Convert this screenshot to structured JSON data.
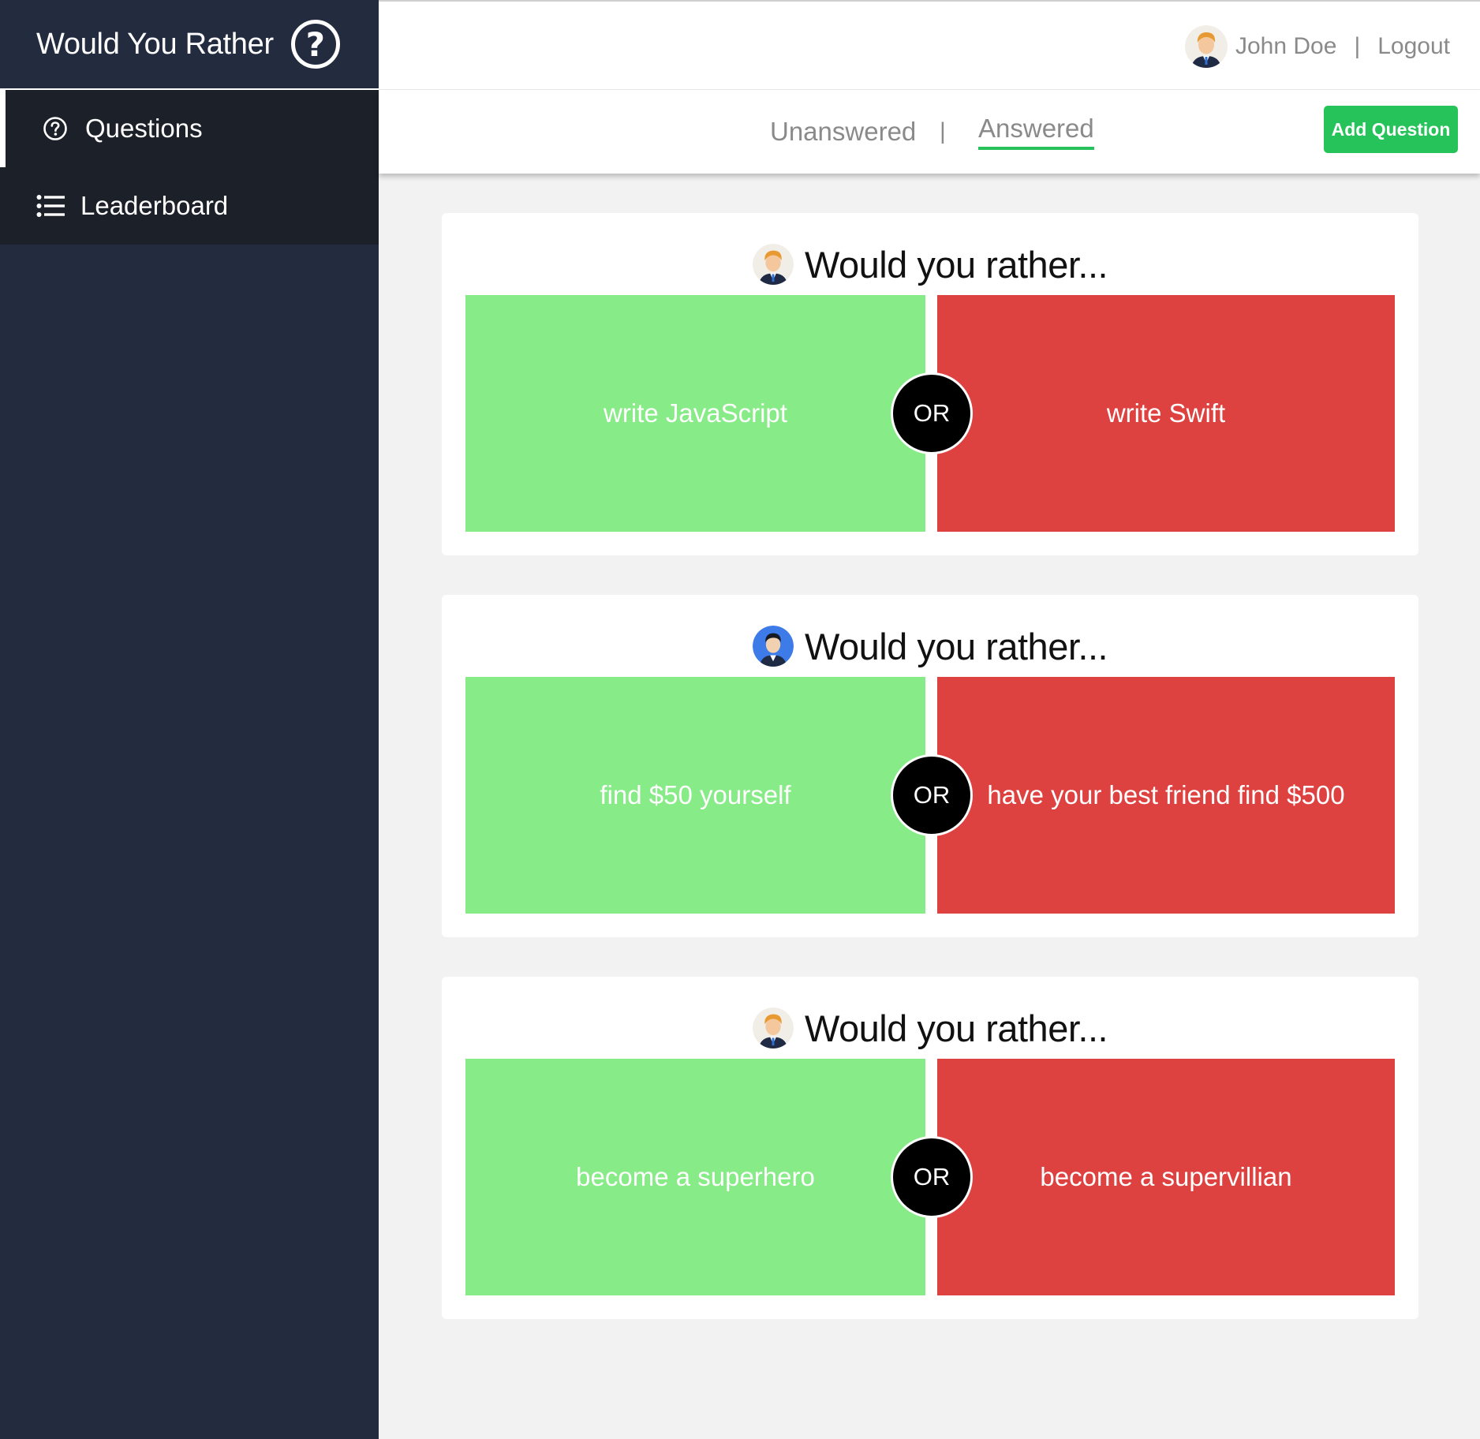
{
  "app": {
    "title": "Would You Rather",
    "brand_icon": "question-circle-icon"
  },
  "sidebar": {
    "items": [
      {
        "label": "Questions",
        "icon": "question-circle-icon",
        "active": true
      },
      {
        "label": "Leaderboard",
        "icon": "list-icon",
        "active": false
      }
    ]
  },
  "header": {
    "user_name": "John Doe",
    "separator": "|",
    "logout_label": "Logout"
  },
  "tabs": {
    "items": [
      {
        "label": "Unanswered",
        "active": false
      },
      {
        "label": "Answered",
        "active": true
      }
    ],
    "separator": "|",
    "add_button_label": "Add Question"
  },
  "questions": [
    {
      "title": "Would you rather...",
      "author_avatar": "blonde-man-avatar",
      "option_a": "write JavaScript",
      "or_label": "OR",
      "option_b": "write Swift"
    },
    {
      "title": "Would you rather...",
      "author_avatar": "dark-hair-man-avatar",
      "option_a": "find $50 yourself",
      "or_label": "OR",
      "option_b": "have your best friend find $500"
    },
    {
      "title": "Would you rather...",
      "author_avatar": "blonde-man-avatar",
      "option_a": "become a superhero",
      "or_label": "OR",
      "option_b": "become a supervillian"
    }
  ],
  "colors": {
    "sidebar_bg": "#232b3f",
    "nav_bg": "#1c2029",
    "accent_green": "#26c35a",
    "option_a_bg": "#87eb87",
    "option_b_bg": "#de4240"
  }
}
